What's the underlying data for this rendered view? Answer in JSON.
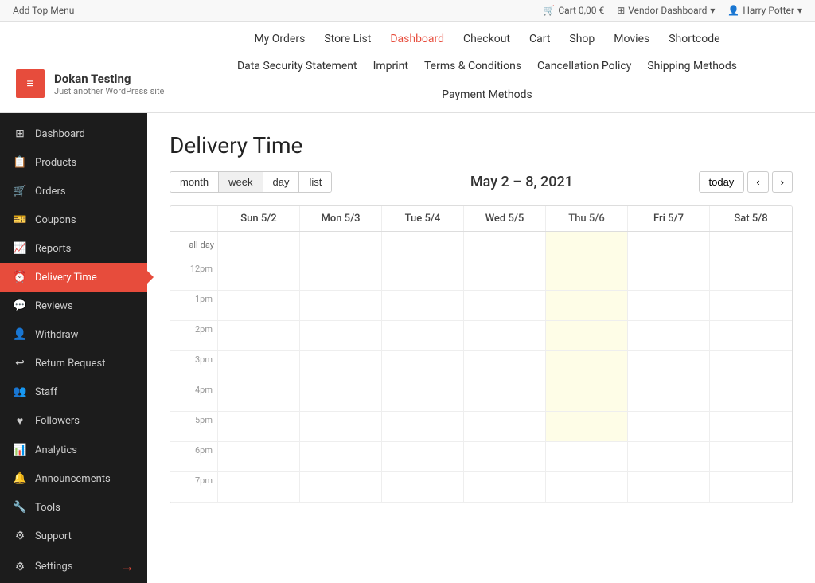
{
  "adminBar": {
    "addTopMenu": "Add Top Menu",
    "cart": "Cart 0,00 €",
    "vendorDashboard": "Vendor Dashboard",
    "user": "Harry Potter"
  },
  "mainNav": {
    "items": [
      {
        "label": "My Orders",
        "active": false
      },
      {
        "label": "Store List",
        "active": false
      },
      {
        "label": "Dashboard",
        "active": true
      },
      {
        "label": "Checkout",
        "active": false
      },
      {
        "label": "Cart",
        "active": false
      },
      {
        "label": "Shop",
        "active": false
      },
      {
        "label": "Movies",
        "active": false
      },
      {
        "label": "Shortcode",
        "active": false
      }
    ]
  },
  "secondaryNav": {
    "items": [
      {
        "label": "Data Security Statement"
      },
      {
        "label": "Imprint"
      },
      {
        "label": "Terms & Conditions"
      },
      {
        "label": "Cancellation Policy"
      },
      {
        "label": "Shipping Methods"
      }
    ]
  },
  "tertiaryNav": {
    "items": [
      {
        "label": "Payment Methods"
      }
    ]
  },
  "siteBranding": {
    "name": "Dokan Testing",
    "tagline": "Just another WordPress site",
    "icon": "≡"
  },
  "sidebar": {
    "items": [
      {
        "label": "Dashboard",
        "icon": "⊞",
        "active": false
      },
      {
        "label": "Products",
        "icon": "🗂",
        "active": false
      },
      {
        "label": "Orders",
        "icon": "🛒",
        "active": false
      },
      {
        "label": "Coupons",
        "icon": "🎫",
        "active": false
      },
      {
        "label": "Reports",
        "icon": "📈",
        "active": false
      },
      {
        "label": "Delivery Time",
        "icon": "🕐",
        "active": true
      },
      {
        "label": "Reviews",
        "icon": "💬",
        "active": false
      },
      {
        "label": "Withdraw",
        "icon": "👤",
        "active": false
      },
      {
        "label": "Return Request",
        "icon": "↩",
        "active": false
      },
      {
        "label": "Staff",
        "icon": "👥",
        "active": false
      },
      {
        "label": "Followers",
        "icon": "💬",
        "active": false
      },
      {
        "label": "Analytics",
        "icon": "📊",
        "active": false
      },
      {
        "label": "Announcements",
        "icon": "🔔",
        "active": false
      },
      {
        "label": "Tools",
        "icon": "🔧",
        "active": false
      },
      {
        "label": "Support",
        "icon": "⚙",
        "active": false
      },
      {
        "label": "Settings",
        "icon": "⚙",
        "active": false
      }
    ]
  },
  "calendar": {
    "pageTitle": "Delivery Time",
    "viewButtons": [
      "month",
      "week",
      "day",
      "list"
    ],
    "activeView": "week",
    "dateRange": "May 2 – 8, 2021",
    "todayButton": "today",
    "prevButton": "‹",
    "nextButton": "›",
    "columns": [
      "Sun 5/2",
      "Mon 5/3",
      "Tue 5/4",
      "Wed 5/5",
      "Thu 5/6",
      "Fri 5/7",
      "Sat 5/8"
    ],
    "allDayLabel": "all-day",
    "timeSlots": [
      "12pm",
      "1pm",
      "2pm",
      "3pm",
      "4pm",
      "5pm",
      "6pm",
      "7pm"
    ],
    "highlightedCol": 4
  }
}
